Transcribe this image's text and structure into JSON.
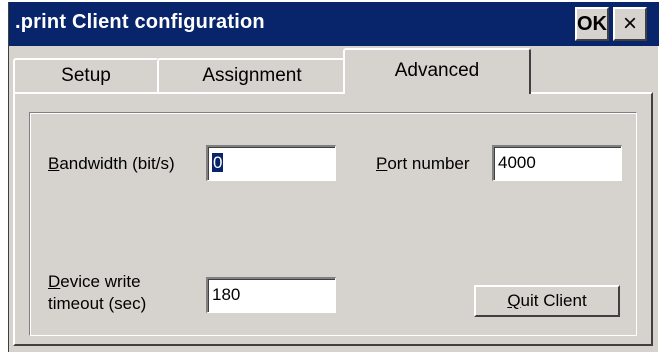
{
  "window": {
    "title": ".print Client configuration",
    "ok_label": "OK",
    "close_label": "×"
  },
  "tabs": [
    {
      "label": "Setup",
      "active": false
    },
    {
      "label": "Assignment",
      "active": false
    },
    {
      "label": "Advanced",
      "active": true
    }
  ],
  "advanced": {
    "bandwidth": {
      "label_mnemonic": "B",
      "label_rest": "andwidth (bit/s)",
      "value": "0"
    },
    "port": {
      "label_mnemonic": "P",
      "label_rest": "ort number",
      "value": "4000"
    },
    "timeout": {
      "label_mnemonic": "D",
      "label_line1_rest": "evice write",
      "label_line2": "timeout (sec)",
      "value": "180"
    },
    "quit_button": {
      "mnemonic": "Q",
      "rest": "uit Client"
    }
  }
}
